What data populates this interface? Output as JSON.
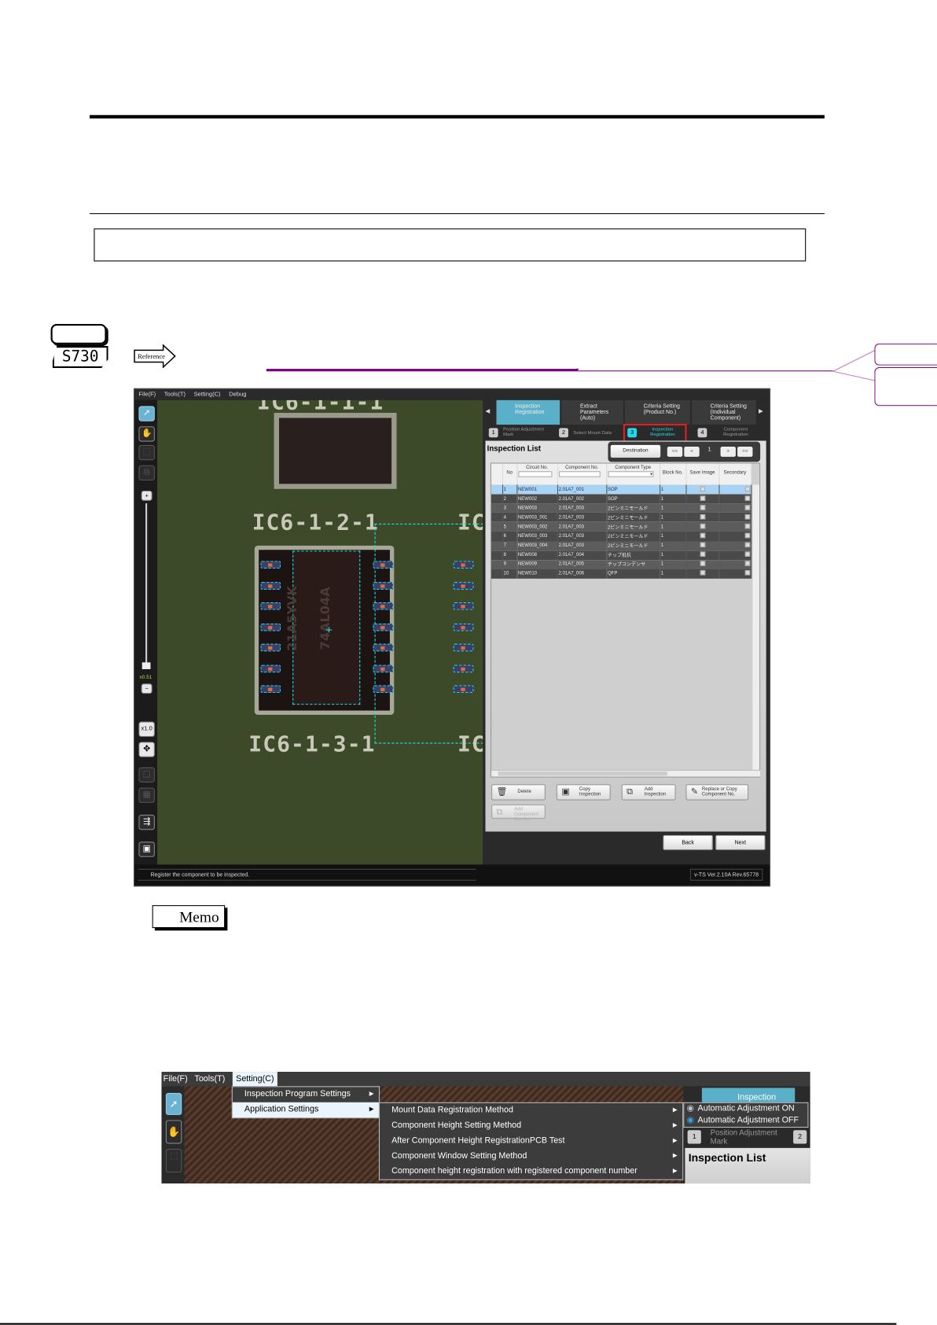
{
  "badge": {
    "code": "S730",
    "reference_label": "Reference"
  },
  "memo_label": "Memo",
  "app": {
    "menu": [
      "File(F)",
      "Tools(T)",
      "Setting(C)",
      "Debug"
    ],
    "zoom_level": "x0.51",
    "zoom_reset": "x1.0",
    "pcb_labels": [
      "IC6-1-1-1",
      "IC6-1-2-1",
      "IC6-1-3-1",
      "IC",
      "IC"
    ],
    "chip_marking": [
      "21A5YVK",
      "74AL04A"
    ],
    "ribbon": [
      "Inspection Registration",
      "Extract Parameters (Auto)",
      "Criteria Setting (Product No.)",
      "Criteria Setting (Individual Component)"
    ],
    "steps": [
      {
        "num": "1",
        "label": "Position Adjustment Mark"
      },
      {
        "num": "2",
        "label": "Select Mount Data"
      },
      {
        "num": "3",
        "label": "Inspection Registration"
      },
      {
        "num": "4",
        "label": "Component Registration"
      }
    ],
    "list_title": "Inspection List",
    "destination": "Destination",
    "pager": {
      "first": "<<",
      "prev": "<",
      "page": "1",
      "next": ">",
      "last": ">>"
    },
    "columns": [
      "No",
      "Circuit No.",
      "Component No.",
      "Component Type",
      "Block No.",
      "Save Image",
      "Secondary"
    ],
    "rows": [
      [
        "1",
        "NEW001",
        "2.01A7_001",
        "SOP",
        "1"
      ],
      [
        "2",
        "NEW002",
        "2.01A7_002",
        "SOP",
        "1"
      ],
      [
        "3",
        "NEW003",
        "2.01A7_003",
        "2ピンミニモールド",
        "1"
      ],
      [
        "4",
        "NEW003_001",
        "2.01A7_003",
        "2ピンミニモールド",
        "1"
      ],
      [
        "5",
        "NEW003_002",
        "2.01A7_003",
        "2ピンミニモールド",
        "1"
      ],
      [
        "6",
        "NEW003_003",
        "2.01A7_003",
        "2ピンミニモールド",
        "1"
      ],
      [
        "7",
        "NEW003_004",
        "2.01A7_003",
        "2ピンミニモールド",
        "1"
      ],
      [
        "8",
        "NEW008",
        "2.01A7_004",
        "チップ抵抗",
        "1"
      ],
      [
        "9",
        "NEW009",
        "2.01A7_005",
        "チップコンデンサ",
        "1"
      ],
      [
        "10",
        "NEW010",
        "2.01A7_006",
        "QFP",
        "1"
      ]
    ],
    "buttons": {
      "delete": "Delete",
      "copy": "Copy Inspection",
      "add": "Add Inspection",
      "replace": "Replace or Copy Component No.",
      "add_component": "Add Component Number",
      "back": "Back",
      "next": "Next"
    },
    "status": "Register the component to be inspected.",
    "version": "v-TS Ver.2.10A Rev.65778"
  },
  "menu_shot": {
    "menu": [
      "File(F)",
      "Tools(T)",
      "Setting(C)"
    ],
    "setting_items": [
      "Inspection Program Settings",
      "Application Settings"
    ],
    "app_settings_items": [
      "Mount Data Registration Method",
      "Component Height Setting Method",
      "After Component Height RegistrationPCB Test",
      "Component Window Setting Method",
      "Component height registration with registered component number"
    ],
    "radio_items": [
      {
        "label": "Automatic Adjustment ON",
        "selected": false
      },
      {
        "label": "Automatic Adjustment OFF",
        "selected": true
      }
    ],
    "tab": "Inspection",
    "step1": "1",
    "step1_label": "Position Adjustment Mark",
    "step2": "2",
    "list_title": "Inspection List"
  },
  "colors": {
    "accent_purple": "#800080",
    "highlight_red": "#e02020",
    "tab_blue": "#5ab0c8",
    "step_cyan": "#27d9e6"
  }
}
